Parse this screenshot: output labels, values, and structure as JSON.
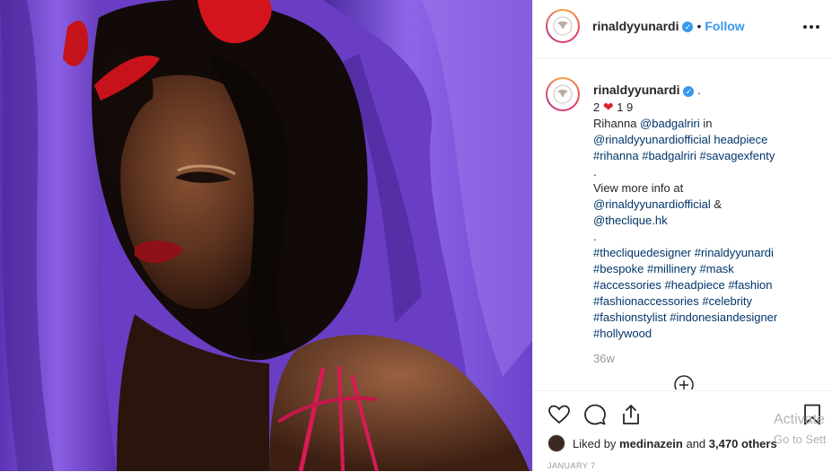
{
  "colors": {
    "link": "#003569",
    "accent_blue": "#3897f0",
    "heart_red": "#e0202e",
    "curtain_purple": "#7a4fd6"
  },
  "header": {
    "username": "rinaldyyunardi",
    "verified_icon": "verified-badge-icon",
    "separator": "•",
    "follow_label": "Follow",
    "more_icon": "more-options-icon"
  },
  "caption": {
    "username": "rinaldyyunardi",
    "trailing": ".",
    "line1_a": "2",
    "line1_b": "1 9",
    "line2_text": "Rihanna ",
    "line2_link": "@badgalriri",
    "line2_tail": " in",
    "line3": "@rinaldyyunardiofficial headpiece",
    "line4": "#rihanna #badgalriri #savagexfenty",
    "line5": ".",
    "line6": "View more info at",
    "line7_link": "@rinaldyyunardiofficial",
    "line7_tail": " &",
    "line8": "@theclique.hk",
    "line9": ".",
    "line10": "#thecliquedesigner #rinaldyyunardi",
    "line11": "#bespoke #millinery #mask",
    "line12": "#accessories #headpiece #fashion",
    "line13": "#fashionaccessories #celebrity",
    "line14": "#fashionstylist #indonesiandesigner",
    "line15": "#hollywood"
  },
  "time_ago": "36w",
  "actions": {
    "like_icon": "heart-outline-icon",
    "comment_icon": "comment-icon",
    "share_icon": "share-icon",
    "save_icon": "bookmark-icon",
    "load_more_icon": "plus-circle-icon"
  },
  "likes": {
    "prefix": "Liked by ",
    "user": "medinazein",
    "middle": " and ",
    "count": "3,470 others"
  },
  "post_date": "JANUARY 7",
  "watermark": {
    "line1": "Activate",
    "line2": "Go to Sett"
  }
}
